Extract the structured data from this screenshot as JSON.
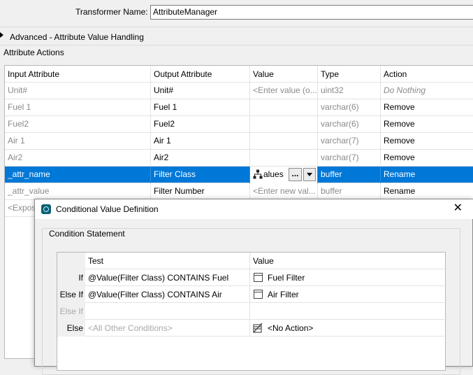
{
  "header": {
    "name_label": "Transformer Name:",
    "name_value": "AttributeManager",
    "advanced_label": "Advanced - Attribute Value Handling",
    "actions_title": "Attribute Actions"
  },
  "table": {
    "columns": [
      "Input Attribute",
      "Output Attribute",
      "Value",
      "Type",
      "Action"
    ],
    "rows": [
      {
        "input": "Unit#",
        "output": "Unit#",
        "value": "<Enter value (o...",
        "type": "uint32",
        "action": "Do Nothing"
      },
      {
        "input": "Fuel 1",
        "output": "Fuel 1",
        "value": "",
        "type": "varchar(6)",
        "action": "Remove"
      },
      {
        "input": "Fuel2",
        "output": "Fuel2",
        "value": "",
        "type": "varchar(6)",
        "action": "Remove"
      },
      {
        "input": "Air 1",
        "output": "Air 1",
        "value": "",
        "type": "varchar(7)",
        "action": "Remove"
      },
      {
        "input": "Air2",
        "output": "Air2",
        "value": "",
        "type": "varchar(7)",
        "action": "Remove"
      },
      {
        "input": "_attr_name",
        "output": "Filter Class",
        "value": "alues",
        "type": "buffer",
        "action": "Rename",
        "ellipsis": "..."
      },
      {
        "input": "_attr_value",
        "output": "Filter Number",
        "value": "<Enter new val...",
        "type": "buffer",
        "action": "Rename"
      },
      {
        "input": "<Expos"
      }
    ]
  },
  "dialog": {
    "title": "Conditional Value Definition",
    "close": "✕",
    "group_label": "Condition Statement",
    "columns": [
      "Test",
      "Value"
    ],
    "conditions": [
      {
        "label": "If",
        "test": "@Value(Filter Class) CONTAINS Fuel",
        "value": "Fuel Filter"
      },
      {
        "label": "Else If",
        "test": "@Value(Filter Class) CONTAINS Air",
        "value": "Air Filter"
      },
      {
        "label": "Else If",
        "test": "",
        "value": ""
      },
      {
        "label": "Else",
        "test": "<All Other Conditions>",
        "value": "<No Action>"
      }
    ]
  },
  "icons": {
    "value_icon": "table-row-icon",
    "no_action_icon": "no-action-icon",
    "tree_icon": "hierarchy-icon",
    "dialog_icon": "fme-app-icon"
  },
  "colors": {
    "selection": "#0078d7",
    "placeholder": "#8a8a8a"
  }
}
